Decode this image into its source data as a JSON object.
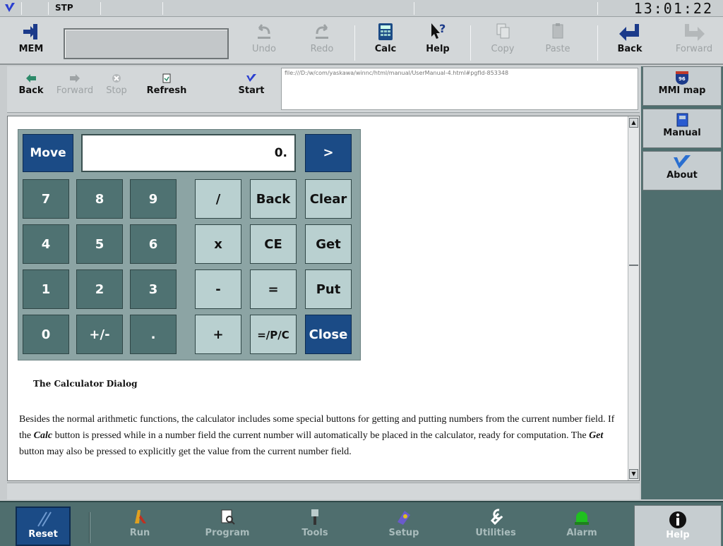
{
  "status": {
    "mode": "STP",
    "clock": "13:01:22"
  },
  "toolbar": {
    "mem_label": "MEM",
    "undo_label": "Undo",
    "redo_label": "Redo",
    "calc_label": "Calc",
    "help_label": "Help",
    "copy_label": "Copy",
    "paste_label": "Paste",
    "back_label": "Back",
    "forward_label": "Forward"
  },
  "browser": {
    "back_label": "Back",
    "forward_label": "Forward",
    "stop_label": "Stop",
    "refresh_label": "Refresh",
    "start_label": "Start",
    "url": "file:///D:/w/com/yaskawa/winnc/html/manual/UserManual-4.html#pgfId-853348"
  },
  "sidebar": {
    "items": [
      {
        "label": "MMI map",
        "icon": "mmi-map-icon"
      },
      {
        "label": "Manual",
        "icon": "book-icon"
      },
      {
        "label": "About",
        "icon": "checkmark-icon"
      }
    ]
  },
  "calculator": {
    "move_label": "Move",
    "display_value": "0.",
    "next_label": ">",
    "keys": {
      "seven": "7",
      "eight": "8",
      "nine": "9",
      "four": "4",
      "five": "5",
      "six": "6",
      "one": "1",
      "two": "2",
      "three": "3",
      "zero": "0",
      "plusminus": "+/-",
      "decimal": ".",
      "divide": "/",
      "multiply": "x",
      "minus": "-",
      "plus": "+",
      "back": "Back",
      "ce": "CE",
      "equals": "=",
      "eqpc": "=/P/C",
      "clear": "Clear",
      "get": "Get",
      "put": "Put",
      "close": "Close"
    }
  },
  "doc": {
    "heading": "The Calculator Dialog",
    "p1": "Besides the normal arithmetic functions, the calculator includes some special buttons for getting and putting numbers from the current number field. If the ",
    "calc_em": "Calc",
    "p2": " button is pressed while in a number field the current number will automatically be placed in the calculator, ready for computation. The ",
    "get_em": "Get",
    "p3": " button may also be pressed to explicitly get the value from the current number field."
  },
  "taskbar": {
    "reset_label": "Reset",
    "run_label": "Run",
    "program_label": "Program",
    "tools_label": "Tools",
    "setup_label": "Setup",
    "utilities_label": "Utilities",
    "alarm_label": "Alarm",
    "help_label": "Help"
  },
  "colors": {
    "accent_blue": "#1b4b86",
    "panel_teal": "#4f6e6e",
    "calc_num_key": "#4f7272",
    "calc_op_key": "#b9d0d0"
  }
}
